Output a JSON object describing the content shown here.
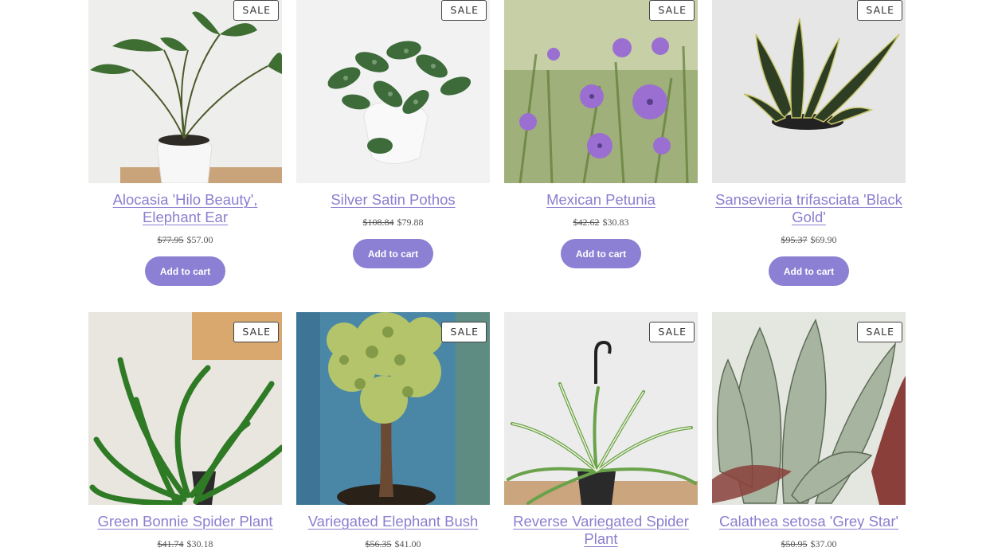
{
  "sale_badge": "SALE",
  "add_to_cart_label": "Add to cart",
  "colors": {
    "accent": "#8b80d3",
    "title_link": "#8a7fcf"
  },
  "products": [
    {
      "name": "Alocasia 'Hilo Beauty', Elephant Ear",
      "old_price": "$77.95",
      "price": "$57.00",
      "on_sale": true,
      "image": "alocasia-plant-photo"
    },
    {
      "name": "Silver Satin Pothos",
      "old_price": "$108.84",
      "price": "$79.88",
      "on_sale": true,
      "image": "pothos-plant-photo"
    },
    {
      "name": "Mexican Petunia",
      "old_price": "$42.62",
      "price": "$30.83",
      "on_sale": true,
      "image": "petunia-flowers-photo"
    },
    {
      "name": "Sansevieria trifasciata 'Black Gold'",
      "old_price": "$95.37",
      "price": "$69.90",
      "on_sale": true,
      "image": "sansevieria-plant-photo"
    },
    {
      "name": "Green Bonnie Spider Plant",
      "old_price": "$41.74",
      "price": "$30.18",
      "on_sale": true,
      "image": "spider-plant-photo"
    },
    {
      "name": "Variegated Elephant Bush",
      "old_price": "$56.35",
      "price": "$41.00",
      "on_sale": true,
      "image": "elephant-bush-photo"
    },
    {
      "name": "Reverse Variegated Spider Plant",
      "old_price": "$..",
      "price": "",
      "on_sale": true,
      "image": "hanging-spider-plant-photo"
    },
    {
      "name": "Calathea setosa 'Grey Star'",
      "old_price": "$50.95",
      "price": "$37.00",
      "on_sale": true,
      "image": "calathea-plant-photo"
    }
  ]
}
